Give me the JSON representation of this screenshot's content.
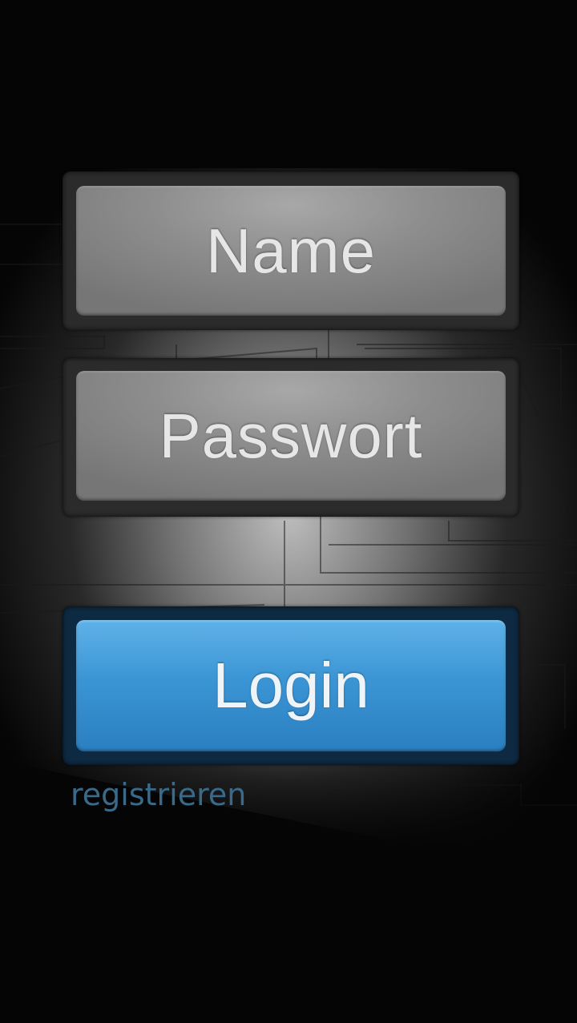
{
  "login_form": {
    "name_placeholder": "Name",
    "password_placeholder": "Passwort",
    "login_label": "Login",
    "register_link": "registrieren"
  },
  "colors": {
    "accent": "#3b95d4",
    "field_gray": "#8e8e8e",
    "link": "#3a6a8a"
  }
}
